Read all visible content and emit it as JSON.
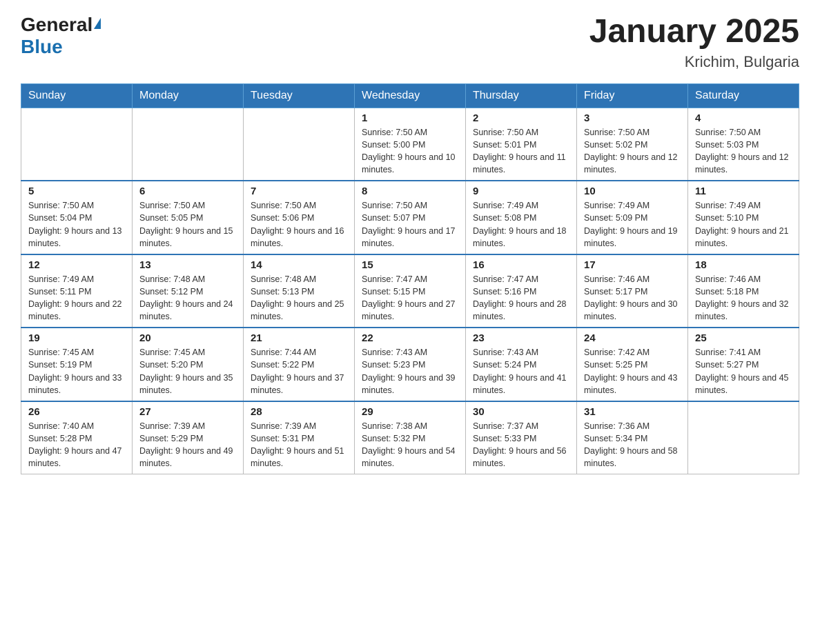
{
  "header": {
    "logo_general": "General",
    "logo_blue": "Blue",
    "title": "January 2025",
    "subtitle": "Krichim, Bulgaria"
  },
  "days_of_week": [
    "Sunday",
    "Monday",
    "Tuesday",
    "Wednesday",
    "Thursday",
    "Friday",
    "Saturday"
  ],
  "weeks": [
    [
      {
        "day": "",
        "info": ""
      },
      {
        "day": "",
        "info": ""
      },
      {
        "day": "",
        "info": ""
      },
      {
        "day": "1",
        "info": "Sunrise: 7:50 AM\nSunset: 5:00 PM\nDaylight: 9 hours\nand 10 minutes."
      },
      {
        "day": "2",
        "info": "Sunrise: 7:50 AM\nSunset: 5:01 PM\nDaylight: 9 hours\nand 11 minutes."
      },
      {
        "day": "3",
        "info": "Sunrise: 7:50 AM\nSunset: 5:02 PM\nDaylight: 9 hours\nand 12 minutes."
      },
      {
        "day": "4",
        "info": "Sunrise: 7:50 AM\nSunset: 5:03 PM\nDaylight: 9 hours\nand 12 minutes."
      }
    ],
    [
      {
        "day": "5",
        "info": "Sunrise: 7:50 AM\nSunset: 5:04 PM\nDaylight: 9 hours\nand 13 minutes."
      },
      {
        "day": "6",
        "info": "Sunrise: 7:50 AM\nSunset: 5:05 PM\nDaylight: 9 hours\nand 15 minutes."
      },
      {
        "day": "7",
        "info": "Sunrise: 7:50 AM\nSunset: 5:06 PM\nDaylight: 9 hours\nand 16 minutes."
      },
      {
        "day": "8",
        "info": "Sunrise: 7:50 AM\nSunset: 5:07 PM\nDaylight: 9 hours\nand 17 minutes."
      },
      {
        "day": "9",
        "info": "Sunrise: 7:49 AM\nSunset: 5:08 PM\nDaylight: 9 hours\nand 18 minutes."
      },
      {
        "day": "10",
        "info": "Sunrise: 7:49 AM\nSunset: 5:09 PM\nDaylight: 9 hours\nand 19 minutes."
      },
      {
        "day": "11",
        "info": "Sunrise: 7:49 AM\nSunset: 5:10 PM\nDaylight: 9 hours\nand 21 minutes."
      }
    ],
    [
      {
        "day": "12",
        "info": "Sunrise: 7:49 AM\nSunset: 5:11 PM\nDaylight: 9 hours\nand 22 minutes."
      },
      {
        "day": "13",
        "info": "Sunrise: 7:48 AM\nSunset: 5:12 PM\nDaylight: 9 hours\nand 24 minutes."
      },
      {
        "day": "14",
        "info": "Sunrise: 7:48 AM\nSunset: 5:13 PM\nDaylight: 9 hours\nand 25 minutes."
      },
      {
        "day": "15",
        "info": "Sunrise: 7:47 AM\nSunset: 5:15 PM\nDaylight: 9 hours\nand 27 minutes."
      },
      {
        "day": "16",
        "info": "Sunrise: 7:47 AM\nSunset: 5:16 PM\nDaylight: 9 hours\nand 28 minutes."
      },
      {
        "day": "17",
        "info": "Sunrise: 7:46 AM\nSunset: 5:17 PM\nDaylight: 9 hours\nand 30 minutes."
      },
      {
        "day": "18",
        "info": "Sunrise: 7:46 AM\nSunset: 5:18 PM\nDaylight: 9 hours\nand 32 minutes."
      }
    ],
    [
      {
        "day": "19",
        "info": "Sunrise: 7:45 AM\nSunset: 5:19 PM\nDaylight: 9 hours\nand 33 minutes."
      },
      {
        "day": "20",
        "info": "Sunrise: 7:45 AM\nSunset: 5:20 PM\nDaylight: 9 hours\nand 35 minutes."
      },
      {
        "day": "21",
        "info": "Sunrise: 7:44 AM\nSunset: 5:22 PM\nDaylight: 9 hours\nand 37 minutes."
      },
      {
        "day": "22",
        "info": "Sunrise: 7:43 AM\nSunset: 5:23 PM\nDaylight: 9 hours\nand 39 minutes."
      },
      {
        "day": "23",
        "info": "Sunrise: 7:43 AM\nSunset: 5:24 PM\nDaylight: 9 hours\nand 41 minutes."
      },
      {
        "day": "24",
        "info": "Sunrise: 7:42 AM\nSunset: 5:25 PM\nDaylight: 9 hours\nand 43 minutes."
      },
      {
        "day": "25",
        "info": "Sunrise: 7:41 AM\nSunset: 5:27 PM\nDaylight: 9 hours\nand 45 minutes."
      }
    ],
    [
      {
        "day": "26",
        "info": "Sunrise: 7:40 AM\nSunset: 5:28 PM\nDaylight: 9 hours\nand 47 minutes."
      },
      {
        "day": "27",
        "info": "Sunrise: 7:39 AM\nSunset: 5:29 PM\nDaylight: 9 hours\nand 49 minutes."
      },
      {
        "day": "28",
        "info": "Sunrise: 7:39 AM\nSunset: 5:31 PM\nDaylight: 9 hours\nand 51 minutes."
      },
      {
        "day": "29",
        "info": "Sunrise: 7:38 AM\nSunset: 5:32 PM\nDaylight: 9 hours\nand 54 minutes."
      },
      {
        "day": "30",
        "info": "Sunrise: 7:37 AM\nSunset: 5:33 PM\nDaylight: 9 hours\nand 56 minutes."
      },
      {
        "day": "31",
        "info": "Sunrise: 7:36 AM\nSunset: 5:34 PM\nDaylight: 9 hours\nand 58 minutes."
      },
      {
        "day": "",
        "info": ""
      }
    ]
  ]
}
